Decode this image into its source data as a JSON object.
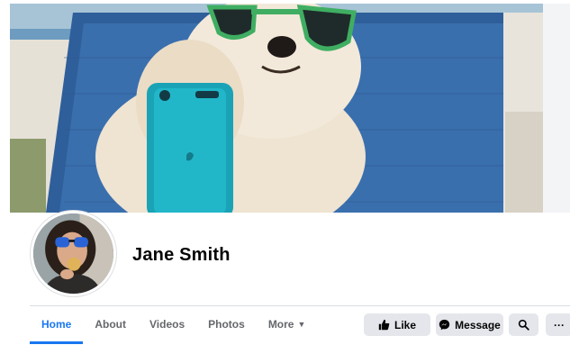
{
  "profile": {
    "name": "Jane Smith"
  },
  "tabs": [
    {
      "label": "Home",
      "active": true
    },
    {
      "label": "About",
      "active": false
    },
    {
      "label": "Videos",
      "active": false
    },
    {
      "label": "Photos",
      "active": false
    },
    {
      "label": "More",
      "active": false
    }
  ],
  "actions": {
    "like_label": "Like",
    "message_label": "Message",
    "more_label": "···"
  },
  "icons": {
    "like": "thumbs-up-icon",
    "message": "messenger-icon",
    "search": "search-icon",
    "more": "more-dots-icon",
    "tab_more": "caret-down-icon"
  },
  "colors": {
    "accent": "#1877f2",
    "button_bg": "#e4e6eb",
    "tab_text": "#65676b",
    "name_text": "#050505"
  }
}
